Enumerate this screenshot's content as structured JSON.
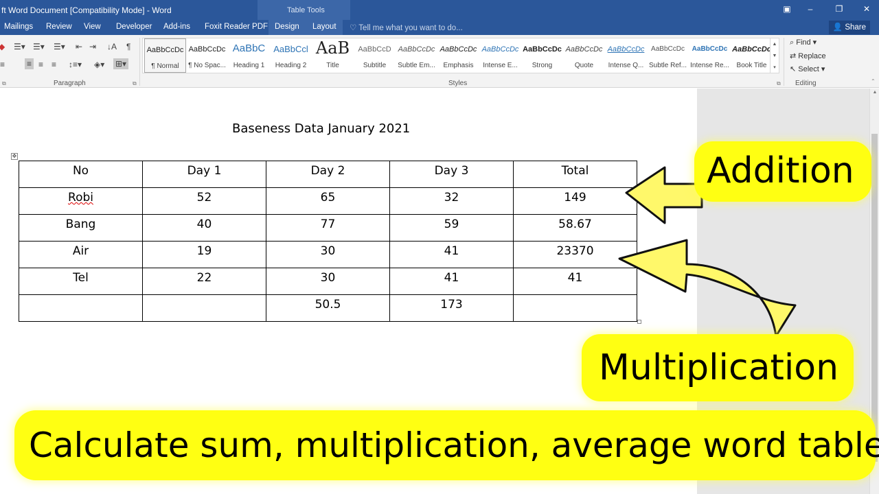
{
  "window": {
    "title": "ft Word Document [Compatibility Mode] - Word",
    "contextual_group": "Table Tools"
  },
  "tabs": [
    "Mailings",
    "Review",
    "View",
    "Developer",
    "Add-ins",
    "Foxit Reader PDF",
    "Design",
    "Layout"
  ],
  "tell_me": "Tell me what you want to do...",
  "share": "Share",
  "ribbon": {
    "paragraph_label": "Paragraph",
    "styles_label": "Styles",
    "editing_label": "Editing",
    "styles": [
      {
        "sample": "AaBbCcDc",
        "name": "¶ Normal"
      },
      {
        "sample": "AaBbCcDc",
        "name": "¶ No Spac..."
      },
      {
        "sample": "AaBbC",
        "name": "Heading 1"
      },
      {
        "sample": "AaBbCcl",
        "name": "Heading 2"
      },
      {
        "sample": "AaB",
        "name": "Title"
      },
      {
        "sample": "AaBbCcD",
        "name": "Subtitle"
      },
      {
        "sample": "AaBbCcDc",
        "name": "Subtle Em..."
      },
      {
        "sample": "AaBbCcDc",
        "name": "Emphasis"
      },
      {
        "sample": "AaBbCcDc",
        "name": "Intense E..."
      },
      {
        "sample": "AaBbCcDc",
        "name": "Strong"
      },
      {
        "sample": "AaBbCcDc",
        "name": "Quote"
      },
      {
        "sample": "AaBbCcDc",
        "name": "Intense Q..."
      },
      {
        "sample": "AaBbCcDc",
        "name": "Subtle Ref..."
      },
      {
        "sample": "AaBbCcDc",
        "name": "Intense Re..."
      },
      {
        "sample": "AaBbCcDc",
        "name": "Book Title"
      }
    ],
    "editing": {
      "find": "Find",
      "replace": "Replace",
      "select": "Select"
    }
  },
  "document": {
    "heading": "Baseness Data January 2021",
    "table": [
      [
        "No",
        "Day 1",
        "Day 2",
        "Day 3",
        "Total"
      ],
      [
        "Robi",
        "52",
        "65",
        "32",
        "149"
      ],
      [
        "Bang",
        "40",
        "77",
        "59",
        "58.67"
      ],
      [
        "Air",
        "19",
        "30",
        "41",
        "23370"
      ],
      [
        "Tel",
        "22",
        "30",
        "41",
        "41"
      ],
      [
        "",
        "",
        "50.5",
        "173",
        ""
      ]
    ]
  },
  "overlay": {
    "addition": "Addition",
    "multiplication": "Multiplication",
    "banner": "Calculate sum, multiplication, average word table"
  }
}
